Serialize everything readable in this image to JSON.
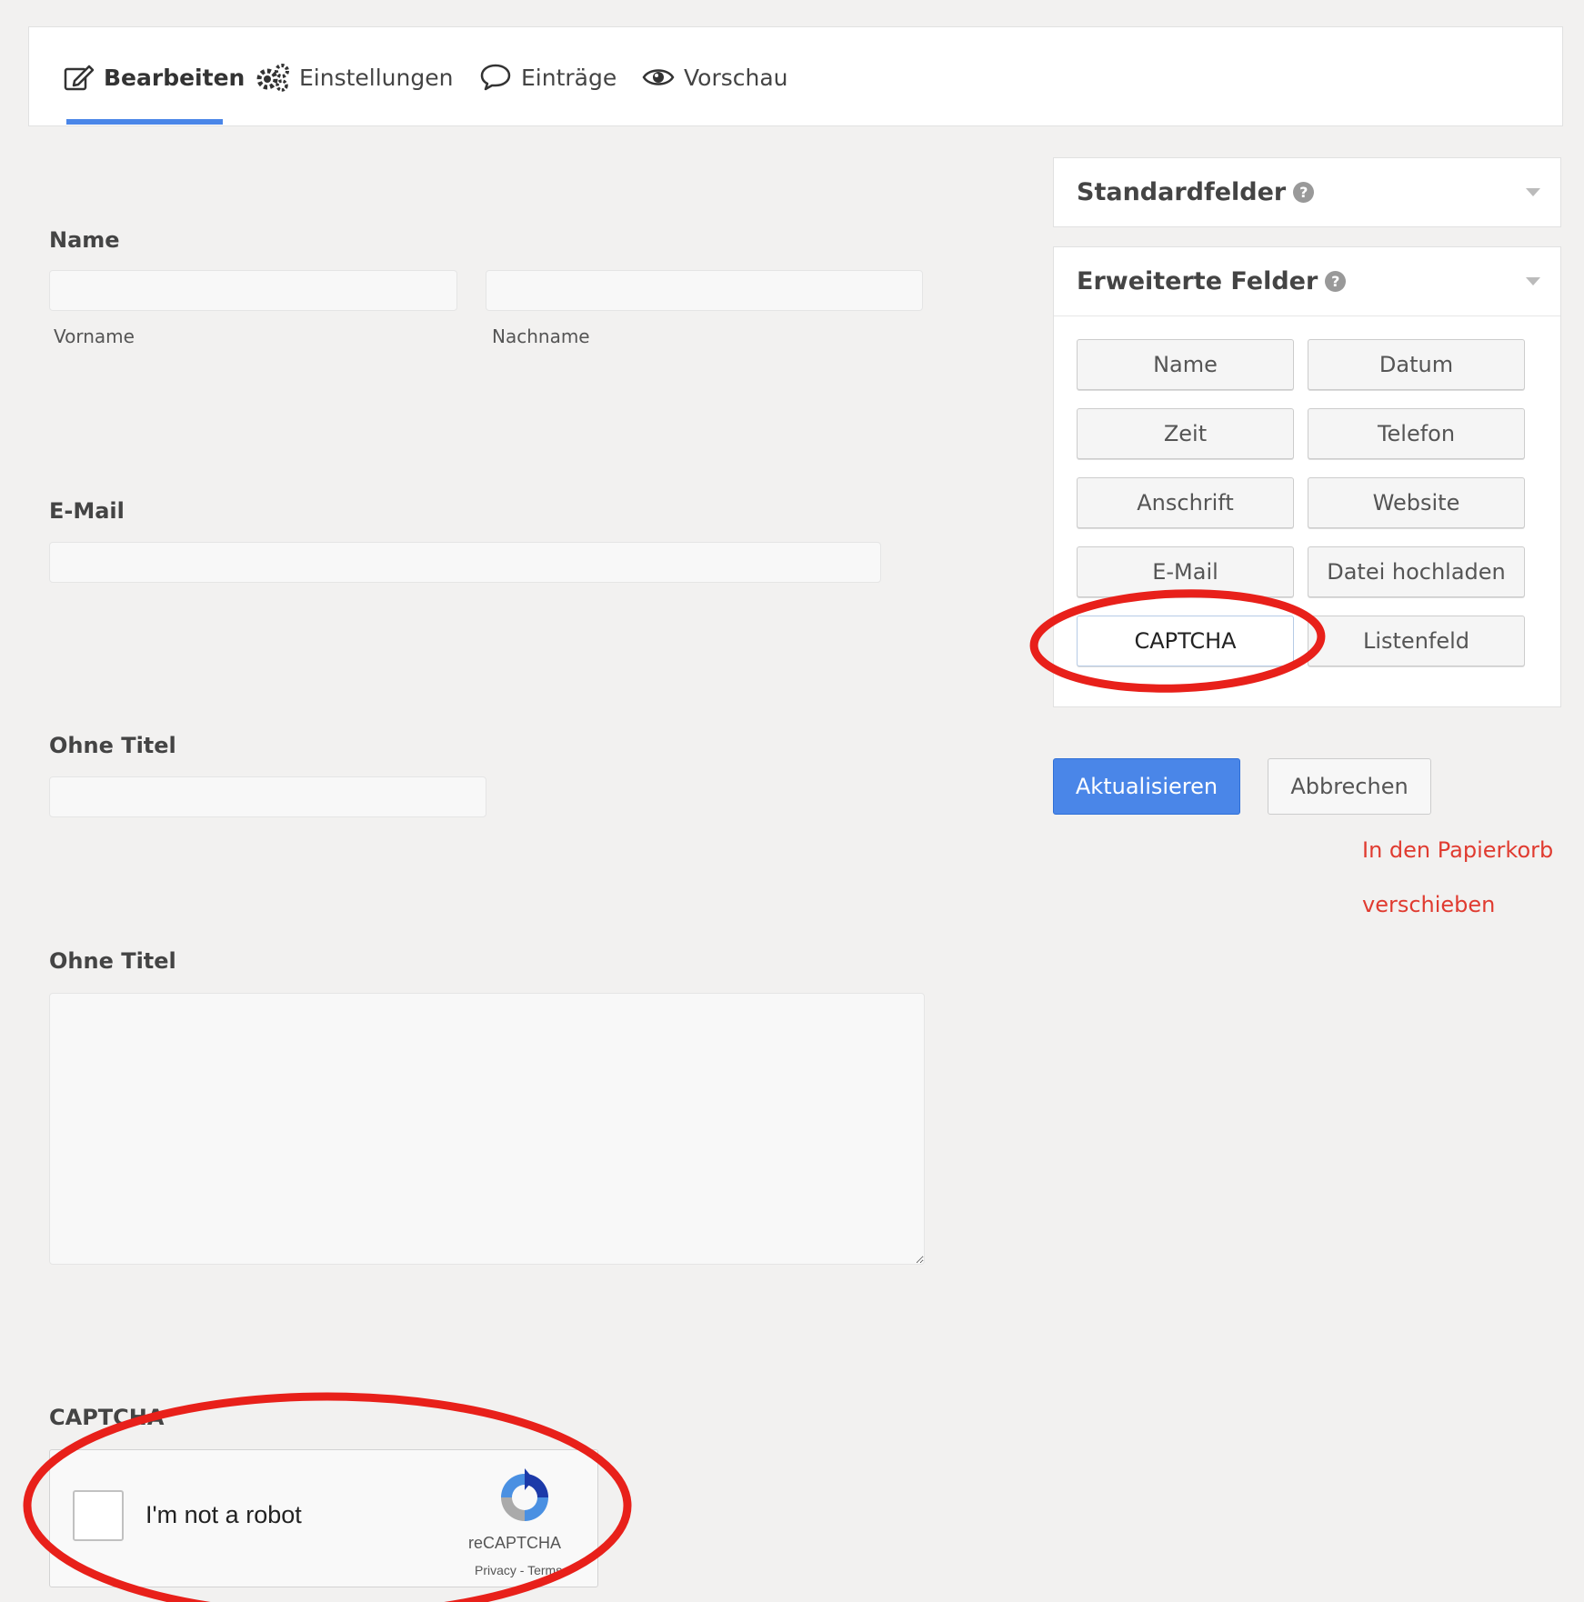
{
  "tabs": [
    {
      "label": "Bearbeiten",
      "icon": "edit-icon",
      "active": true
    },
    {
      "label": "Einstellungen",
      "icon": "gears-icon",
      "active": false
    },
    {
      "label": "Einträge",
      "icon": "speech-bubble-icon",
      "active": false
    },
    {
      "label": "Vorschau",
      "icon": "eye-icon",
      "active": false
    }
  ],
  "form": {
    "name_label": "Name",
    "first_name_label": "Vorname",
    "last_name_label": "Nachname",
    "first_name_value": "",
    "last_name_value": "",
    "email_label": "E-Mail",
    "email_value": "",
    "untitled1_label": "Ohne Titel",
    "untitled1_value": "",
    "untitled2_label": "Ohne Titel",
    "untitled2_value": "",
    "captcha_label": "CAPTCHA"
  },
  "recaptcha": {
    "checkbox_text": "I'm not a robot",
    "brand": "reCAPTCHA",
    "links": "Privacy - Terms"
  },
  "panels": {
    "standard": {
      "title": "Standardfelder",
      "help": "?"
    },
    "advanced": {
      "title": "Erweiterte Felder",
      "help": "?",
      "buttons": [
        "Name",
        "Datum",
        "Zeit",
        "Telefon",
        "Anschrift",
        "Website",
        "E-Mail",
        "Datei hochladen",
        "CAPTCHA",
        "Listenfeld"
      ]
    }
  },
  "actions": {
    "update": "Aktualisieren",
    "cancel": "Abbrechen",
    "trash": "In den Papierkorb verschieben"
  },
  "colors": {
    "accent": "#4a86e8",
    "danger": "#e03b30",
    "annotation": "#e8201a"
  }
}
